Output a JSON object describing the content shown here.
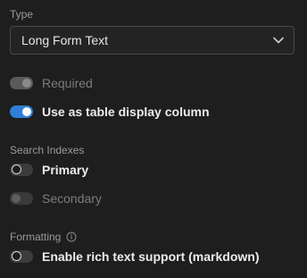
{
  "type_section": {
    "label": "Type",
    "selected_value": "Long Form Text"
  },
  "toggles": {
    "required": {
      "label": "Required",
      "on": true,
      "disabled": true
    },
    "table_display": {
      "label": "Use as table display column",
      "on": true,
      "disabled": false
    }
  },
  "search_indexes": {
    "label": "Search Indexes",
    "primary": {
      "label": "Primary",
      "on": false,
      "disabled": false
    },
    "secondary": {
      "label": "Secondary",
      "on": false,
      "disabled": true
    }
  },
  "formatting": {
    "label": "Formatting",
    "rich_text": {
      "label": "Enable rich text support (markdown)",
      "on": false,
      "disabled": false
    }
  },
  "colors": {
    "background": "#1e1e1e",
    "accent": "#2f7fd8"
  }
}
